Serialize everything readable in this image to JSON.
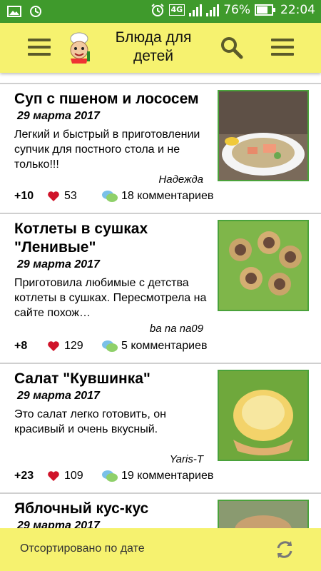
{
  "status_bar": {
    "network": "4G",
    "battery_percent": "76%",
    "battery_level": 0.76,
    "time": "22:04"
  },
  "app_bar": {
    "title": "Блюда для детей",
    "icons": [
      "menu-icon",
      "chef-logo",
      "search-icon",
      "menu-icon"
    ]
  },
  "recipes": [
    {
      "title": "Суп с пшеном и лососем",
      "date": "29 марта 2017",
      "description": "Легкий и быстрый в приготовлении супчик для постного стола и не только!!!",
      "author": "Надежда",
      "score": "+10",
      "likes": "53",
      "comments": "18 комментариев"
    },
    {
      "title": "Котлеты в сушках \"Ленивые\"",
      "date": "29 марта 2017",
      "description": "Приготовила любимые с детства котлеты в сушках. Пересмотрела на сайте похож…",
      "author": "ba na na09",
      "score": "+8",
      "likes": "129",
      "comments": "5 комментариев"
    },
    {
      "title": "Салат \"Кувшинка\"",
      "date": "29 марта 2017",
      "description": "Это салат легко готовить, он красивый и очень вкусный.",
      "author": "Yaris-T",
      "score": "+23",
      "likes": "109",
      "comments": "19 комментариев"
    },
    {
      "title": "Яблочный кус-кус",
      "date": "29 марта 2017"
    }
  ],
  "footer": {
    "sort_label": "Отсортировано по дате"
  },
  "colors": {
    "status_bar": "#3f9a2c",
    "app_bar": "#f6f26f",
    "thumb_border": "#4aa23b",
    "heart": "#d0142a"
  }
}
